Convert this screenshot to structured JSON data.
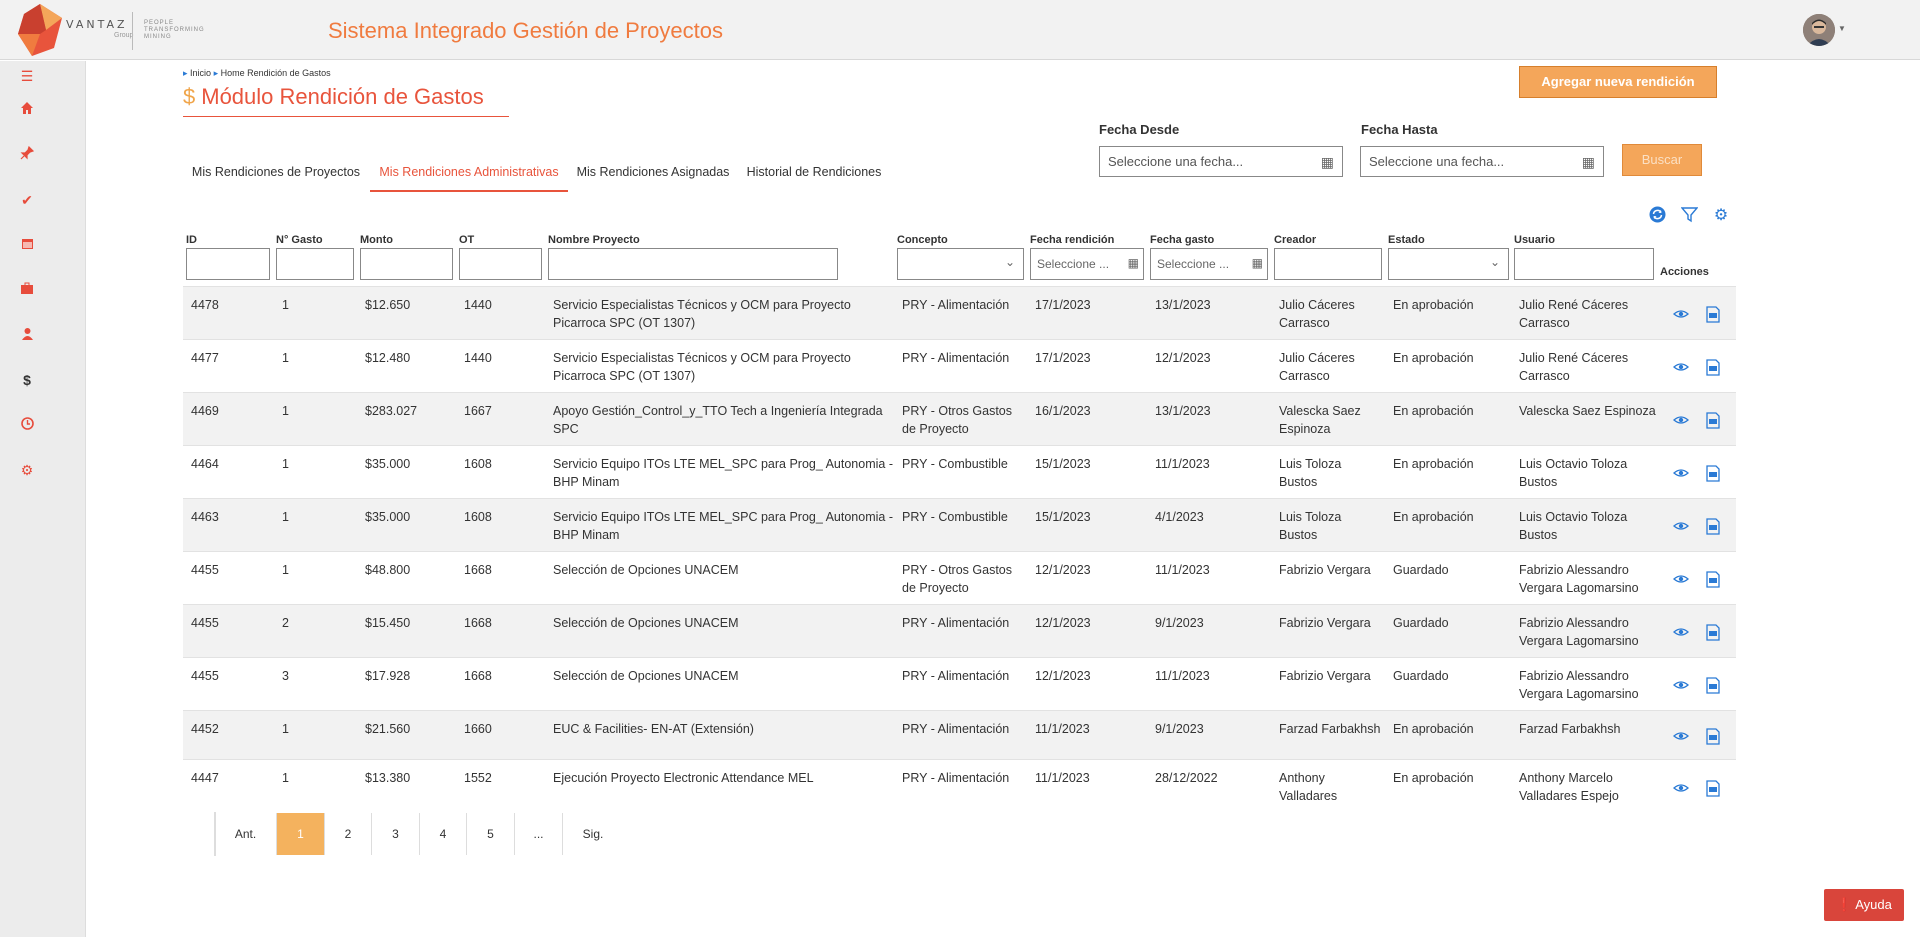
{
  "header": {
    "logo_text": "VANTAZ",
    "logo_sub": "Group",
    "logo_tagline": [
      "PEOPLE",
      "TRANSFORMING",
      "MINING"
    ],
    "app_title": "Sistema Integrado Gestión de Proyectos"
  },
  "sidebar": {
    "icons": [
      "menu-icon",
      "home-icon",
      "pin-icon",
      "check-icon",
      "calendar-icon",
      "briefcase-icon",
      "user-icon",
      "dollar-icon",
      "clock-icon",
      "gear-icon"
    ]
  },
  "breadcrumb": {
    "home": "Inicio",
    "current": "Home Rendición de Gastos"
  },
  "page": {
    "title_symbol": "$",
    "title": "Módulo Rendición de Gastos"
  },
  "actions": {
    "add_label": "Agregar nueva rendición",
    "search_label": "Buscar",
    "help_label": "Ayuda"
  },
  "filters": {
    "date_from_label": "Fecha Desde",
    "date_to_label": "Fecha Hasta",
    "date_placeholder": "Seleccione una fecha..."
  },
  "tabs": [
    {
      "label": "Mis Rendiciones de Proyectos"
    },
    {
      "label": "Mis Rendiciones Administrativas",
      "active": true
    },
    {
      "label": "Mis Rendiciones Asignadas"
    },
    {
      "label": "Historial de Rendiciones"
    }
  ],
  "table": {
    "columns": [
      "ID",
      "N° Gasto",
      "Monto",
      "OT",
      "Nombre Proyecto",
      "Concepto",
      "Fecha rendición",
      "Fecha gasto",
      "Creador",
      "Estado",
      "Usuario",
      "Acciones"
    ],
    "date_filter_placeholder": "Seleccione ...",
    "rows": [
      {
        "id": "4478",
        "n": "1",
        "monto": "$12.650",
        "ot": "1440",
        "proyecto": [
          "Servicio Especialistas Técnicos y OCM para Proyecto",
          "Picarroca SPC (OT 1307)"
        ],
        "concepto": [
          "PRY - Alimentación"
        ],
        "f_rend": "17/1/2023",
        "f_gasto": "13/1/2023",
        "creador": [
          "Julio Cáceres",
          "Carrasco"
        ],
        "estado": "En aprobación",
        "usuario": [
          "Julio René Cáceres",
          "Carrasco"
        ]
      },
      {
        "id": "4477",
        "n": "1",
        "monto": "$12.480",
        "ot": "1440",
        "proyecto": [
          "Servicio Especialistas Técnicos y OCM para Proyecto",
          "Picarroca SPC (OT 1307)"
        ],
        "concepto": [
          "PRY - Alimentación"
        ],
        "f_rend": "17/1/2023",
        "f_gasto": "12/1/2023",
        "creador": [
          "Julio Cáceres",
          "Carrasco"
        ],
        "estado": "En aprobación",
        "usuario": [
          "Julio René Cáceres",
          "Carrasco"
        ]
      },
      {
        "id": "4469",
        "n": "1",
        "monto": "$283.027",
        "ot": "1667",
        "proyecto": [
          "Apoyo Gestión_Control_y_TTO Tech a Ingeniería Integrada",
          "SPC"
        ],
        "concepto": [
          "PRY - Otros Gastos",
          "de Proyecto"
        ],
        "f_rend": "16/1/2023",
        "f_gasto": "13/1/2023",
        "creador": [
          "Valescka Saez",
          "Espinoza"
        ],
        "estado": "En aprobación",
        "usuario": [
          "Valescka Saez Espinoza"
        ]
      },
      {
        "id": "4464",
        "n": "1",
        "monto": "$35.000",
        "ot": "1608",
        "proyecto": [
          "Servicio Equipo ITOs LTE MEL_SPC para Prog_ Autonomia -",
          "BHP Minam"
        ],
        "concepto": [
          "PRY - Combustible"
        ],
        "f_rend": "15/1/2023",
        "f_gasto": "11/1/2023",
        "creador": [
          "Luis Toloza",
          "Bustos"
        ],
        "estado": "En aprobación",
        "usuario": [
          "Luis Octavio Toloza",
          "Bustos"
        ]
      },
      {
        "id": "4463",
        "n": "1",
        "monto": "$35.000",
        "ot": "1608",
        "proyecto": [
          "Servicio Equipo ITOs LTE MEL_SPC para Prog_ Autonomia -",
          "BHP Minam"
        ],
        "concepto": [
          "PRY - Combustible"
        ],
        "f_rend": "15/1/2023",
        "f_gasto": "4/1/2023",
        "creador": [
          "Luis Toloza",
          "Bustos"
        ],
        "estado": "En aprobación",
        "usuario": [
          "Luis Octavio Toloza",
          "Bustos"
        ]
      },
      {
        "id": "4455",
        "n": "1",
        "monto": "$48.800",
        "ot": "1668",
        "proyecto": [
          "Selección de Opciones UNACEM"
        ],
        "concepto": [
          "PRY - Otros Gastos",
          "de Proyecto"
        ],
        "f_rend": "12/1/2023",
        "f_gasto": "11/1/2023",
        "creador": [
          "Fabrizio Vergara"
        ],
        "estado": "Guardado",
        "usuario": [
          "Fabrizio Alessandro",
          "Vergara Lagomarsino"
        ]
      },
      {
        "id": "4455",
        "n": "2",
        "monto": "$15.450",
        "ot": "1668",
        "proyecto": [
          "Selección de Opciones UNACEM"
        ],
        "concepto": [
          "PRY - Alimentación"
        ],
        "f_rend": "12/1/2023",
        "f_gasto": "9/1/2023",
        "creador": [
          "Fabrizio Vergara"
        ],
        "estado": "Guardado",
        "usuario": [
          "Fabrizio Alessandro",
          "Vergara Lagomarsino"
        ]
      },
      {
        "id": "4455",
        "n": "3",
        "monto": "$17.928",
        "ot": "1668",
        "proyecto": [
          "Selección de Opciones UNACEM"
        ],
        "concepto": [
          "PRY - Alimentación"
        ],
        "f_rend": "12/1/2023",
        "f_gasto": "11/1/2023",
        "creador": [
          "Fabrizio Vergara"
        ],
        "estado": "Guardado",
        "usuario": [
          "Fabrizio Alessandro",
          "Vergara Lagomarsino"
        ]
      },
      {
        "id": "4452",
        "n": "1",
        "monto": "$21.560",
        "ot": "1660",
        "proyecto": [
          "EUC & Facilities- EN-AT (Extensión)"
        ],
        "concepto": [
          "PRY - Alimentación"
        ],
        "f_rend": "11/1/2023",
        "f_gasto": "9/1/2023",
        "creador": [
          "Farzad Farbakhsh"
        ],
        "estado": "En aprobación",
        "usuario": [
          "Farzad Farbakhsh"
        ]
      },
      {
        "id": "4447",
        "n": "1",
        "monto": "$13.380",
        "ot": "1552",
        "proyecto": [
          "Ejecución Proyecto Electronic Attendance MEL"
        ],
        "concepto": [
          "PRY - Alimentación"
        ],
        "f_rend": "11/1/2023",
        "f_gasto": "28/12/2022",
        "creador": [
          "Anthony",
          "Valladares"
        ],
        "estado": "En aprobación",
        "usuario": [
          "Anthony Marcelo",
          "Valladares Espejo"
        ]
      }
    ]
  },
  "pagination": {
    "prev": "Ant.",
    "pages": [
      "1",
      "2",
      "3",
      "4",
      "5",
      "..."
    ],
    "next": "Sig.",
    "active": "1"
  },
  "colors": {
    "accent": "#f07b3f",
    "title_red": "#e8543c",
    "button_orange": "#f4a65a",
    "icon_blue": "#2a7ad5",
    "help_red": "#d9453b"
  }
}
